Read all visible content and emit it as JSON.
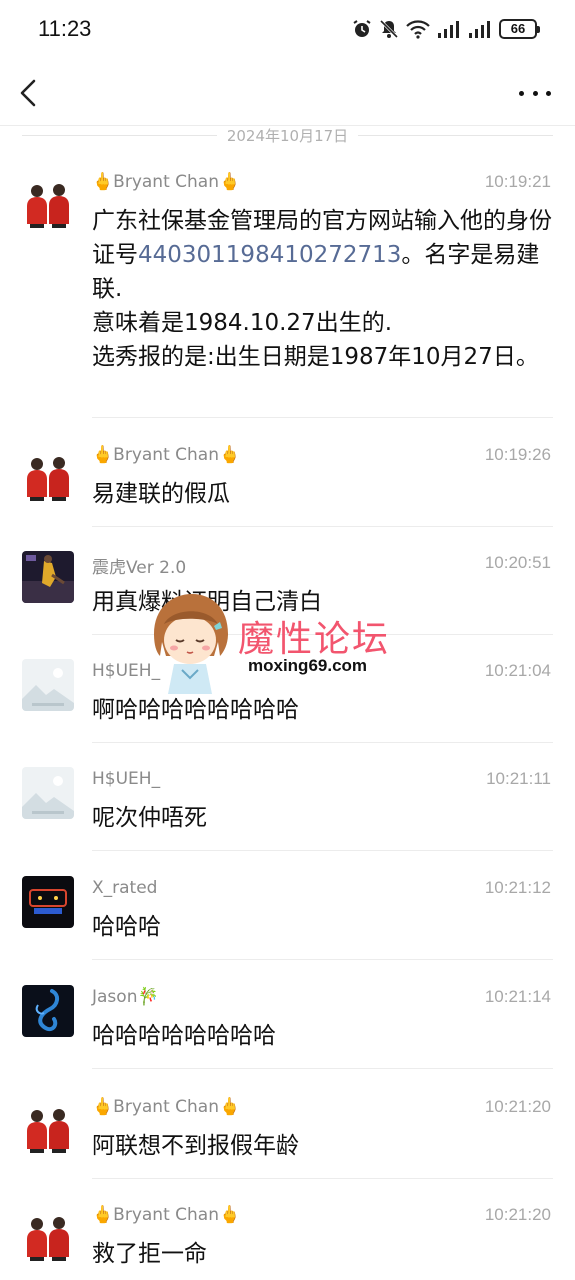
{
  "status_bar": {
    "time": "11:23",
    "battery": "66",
    "icons": [
      "alarm-icon",
      "mute-icon",
      "wifi-icon",
      "signal-icon",
      "signal-icon",
      "battery-icon"
    ]
  },
  "nav": {
    "back_icon": "chevron-left-icon",
    "more_icon": "more-dots-icon"
  },
  "date_divider": "2024年10月17日",
  "messages": [
    {
      "name_prefix": "🖕",
      "name": "Bryant Chan",
      "name_suffix": "🖕",
      "time": "10:19:21",
      "avatar": "two-people-red-avatar",
      "text_lines": [
        {
          "before": "广东社保基金管理局的官方网站输入他的身份证号",
          "link": "440301198410272713",
          "after": "。名字是易建联."
        },
        {
          "before": "意味着是1984.10.27出生的.",
          "link": "",
          "after": ""
        },
        {
          "before": "选秀报的是:出生日期是1987年10月27日。",
          "link": "",
          "after": ""
        }
      ]
    },
    {
      "name_prefix": "🖕",
      "name": "Bryant Chan",
      "name_suffix": "🖕",
      "time": "10:19:26",
      "avatar": "two-people-red-avatar",
      "text": "易建联的假瓜"
    },
    {
      "name_prefix": "",
      "name": "震虎Ver 2.0",
      "name_suffix": "",
      "time": "10:20:51",
      "avatar": "basketball-player-avatar",
      "text": "用真爆料证明自己清白"
    },
    {
      "name_prefix": "",
      "name": "H$UEH_",
      "name_suffix": "",
      "time": "10:21:04",
      "avatar": "placeholder-image-avatar",
      "text": "啊哈哈哈哈哈哈哈哈"
    },
    {
      "name_prefix": "",
      "name": "H$UEH_",
      "name_suffix": "",
      "time": "10:21:11",
      "avatar": "placeholder-image-avatar",
      "text": "呢次仲唔死"
    },
    {
      "name_prefix": "",
      "name": "X_rated",
      "name_suffix": "",
      "time": "10:21:12",
      "avatar": "neon-sign-avatar",
      "text": "哈哈哈"
    },
    {
      "name_prefix": "",
      "name": "Jason",
      "name_suffix": "🎋",
      "time": "10:21:14",
      "avatar": "blue-swirl-avatar",
      "text": "哈哈哈哈哈哈哈哈"
    },
    {
      "name_prefix": "🖕",
      "name": "Bryant Chan",
      "name_suffix": "🖕",
      "time": "10:21:20",
      "avatar": "two-people-red-avatar",
      "text": "阿联想不到报假年龄"
    },
    {
      "name_prefix": "🖕",
      "name": "Bryant Chan",
      "name_suffix": "🖕",
      "time": "10:21:20",
      "avatar": "two-people-red-avatar",
      "text": "救了拒一命"
    }
  ],
  "watermark": {
    "title": "魔性论坛",
    "url": "moxing69.com"
  },
  "colors": {
    "link": "#576b95",
    "name": "#8a8a8a",
    "time": "#a8a8a8",
    "watermark": "#f2556e",
    "accent_red": "#d22a22"
  }
}
